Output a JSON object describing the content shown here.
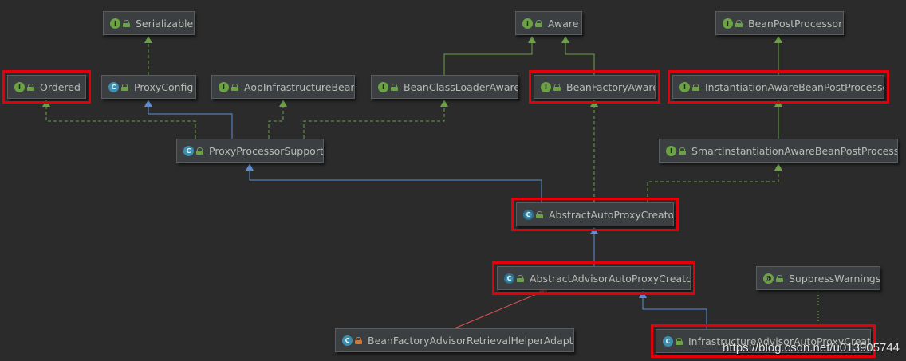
{
  "diagram": {
    "nodes": [
      {
        "id": "serializable",
        "label": "Serializable",
        "kind": "interface",
        "badge": "I",
        "highlighted": false
      },
      {
        "id": "aware",
        "label": "Aware",
        "kind": "interface",
        "badge": "I",
        "highlighted": false
      },
      {
        "id": "beanpostprocessor",
        "label": "BeanPostProcessor",
        "kind": "interface",
        "badge": "I",
        "highlighted": false
      },
      {
        "id": "ordered",
        "label": "Ordered",
        "kind": "interface",
        "badge": "I",
        "highlighted": true
      },
      {
        "id": "proxyconfig",
        "label": "ProxyConfig",
        "kind": "class",
        "badge": "C",
        "highlighted": false
      },
      {
        "id": "aopinfra",
        "label": "AopInfrastructureBean",
        "kind": "interface",
        "badge": "I",
        "highlighted": false
      },
      {
        "id": "beanclassloaderaware",
        "label": "BeanClassLoaderAware",
        "kind": "interface",
        "badge": "I",
        "highlighted": false
      },
      {
        "id": "beanfactoryaware",
        "label": "BeanFactoryAware",
        "kind": "interface",
        "badge": "I",
        "highlighted": true
      },
      {
        "id": "instantiationaware",
        "label": "InstantiationAwareBeanPostProcessor",
        "kind": "interface",
        "badge": "I",
        "highlighted": true
      },
      {
        "id": "proxyprocessorsupport",
        "label": "ProxyProcessorSupport",
        "kind": "class",
        "badge": "C",
        "highlighted": false
      },
      {
        "id": "smartinstantiation",
        "label": "SmartInstantiationAwareBeanPostProcessor",
        "kind": "interface",
        "badge": "I",
        "highlighted": false
      },
      {
        "id": "abstractautoproxycreator",
        "label": "AbstractAutoProxyCreator",
        "kind": "abstract",
        "badge": "C",
        "highlighted": true
      },
      {
        "id": "abstractadvisorautoproxycreator",
        "label": "AbstractAdvisorAutoProxyCreator",
        "kind": "abstract",
        "badge": "C",
        "highlighted": true
      },
      {
        "id": "suppresswarnings",
        "label": "SuppressWarnings",
        "kind": "annotation",
        "badge": "@",
        "highlighted": false
      },
      {
        "id": "beanfactoryadvisorretrieval",
        "label": "BeanFactoryAdvisorRetrievalHelperAdapter",
        "kind": "class",
        "badge": "C",
        "highlighted": false,
        "private": true
      },
      {
        "id": "infrastructureadvisor",
        "label": "InfrastructureAdvisorAutoProxyCreator",
        "kind": "class",
        "badge": "C",
        "highlighted": true
      }
    ],
    "colors": {
      "background": "#2b2b2b",
      "interface_edge": "#6ba344",
      "extends_edge": "#5a8fd6",
      "inner_edge": "#d9534f",
      "annotation_edge": "#6ba344",
      "highlight": "#e3000b"
    }
  },
  "watermark": "https://blog.csdn.net/u013905744"
}
